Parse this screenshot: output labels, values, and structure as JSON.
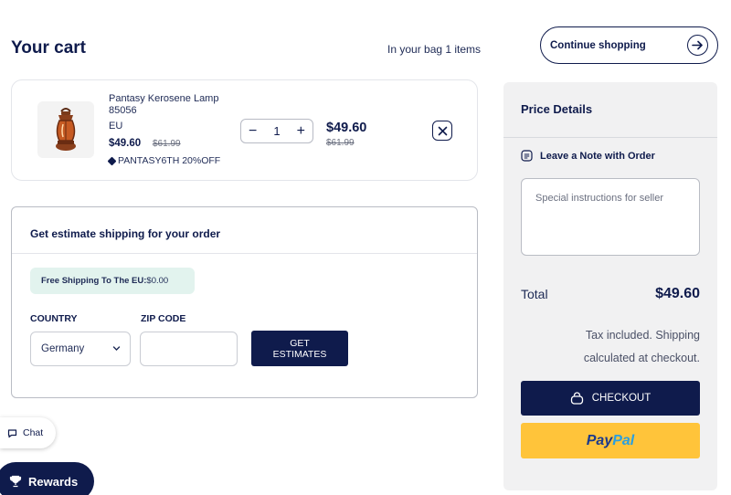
{
  "header": {
    "title": "Your cart",
    "bag_count_text": "In your bag 1 items",
    "continue_label": "Continue shopping"
  },
  "item": {
    "name": "Pantasy Kerosene Lamp 85056",
    "variant": "EU",
    "price": "$49.60",
    "compare_price": "$61.99",
    "discount_code": "PANTASY6TH 20%OFF",
    "quantity": "1",
    "line_price": "$49.60",
    "line_compare_price": "$61.99"
  },
  "shipping": {
    "title": "Get estimate shipping for your order",
    "free_label": "Free Shipping To The EU:",
    "free_value": "$0.00",
    "country_label": "COUNTRY",
    "country_value": "Germany",
    "zip_label": "ZIP CODE",
    "zip_value": "",
    "get_estimates_line1": "GET",
    "get_estimates_line2": "ESTIMATES"
  },
  "widgets": {
    "chat_label": "Chat",
    "rewards_label": "Rewards"
  },
  "price_details": {
    "title": "Price Details",
    "note_label": "Leave a Note with Order",
    "note_placeholder": "Special instructions for seller",
    "total_label": "Total",
    "total_value": "$49.60",
    "tax_line1": "Tax included. Shipping",
    "tax_line2": "calculated at checkout.",
    "checkout_label": "CHECKOUT",
    "paypal_part1": "Pay",
    "paypal_part2": "Pal"
  },
  "colors": {
    "navy": "#0f1b4c",
    "free_shipping_bg": "#e2f3ee",
    "panel_bg": "#f1f1f2",
    "paypal_yellow": "#ffc43a"
  },
  "icons": [
    "arrow-right-icon",
    "lamp-image",
    "tag-icon",
    "minus-icon",
    "plus-icon",
    "close-icon",
    "chevron-down-icon",
    "note-icon",
    "bag-icon",
    "chat-icon",
    "trophy-icon"
  ]
}
